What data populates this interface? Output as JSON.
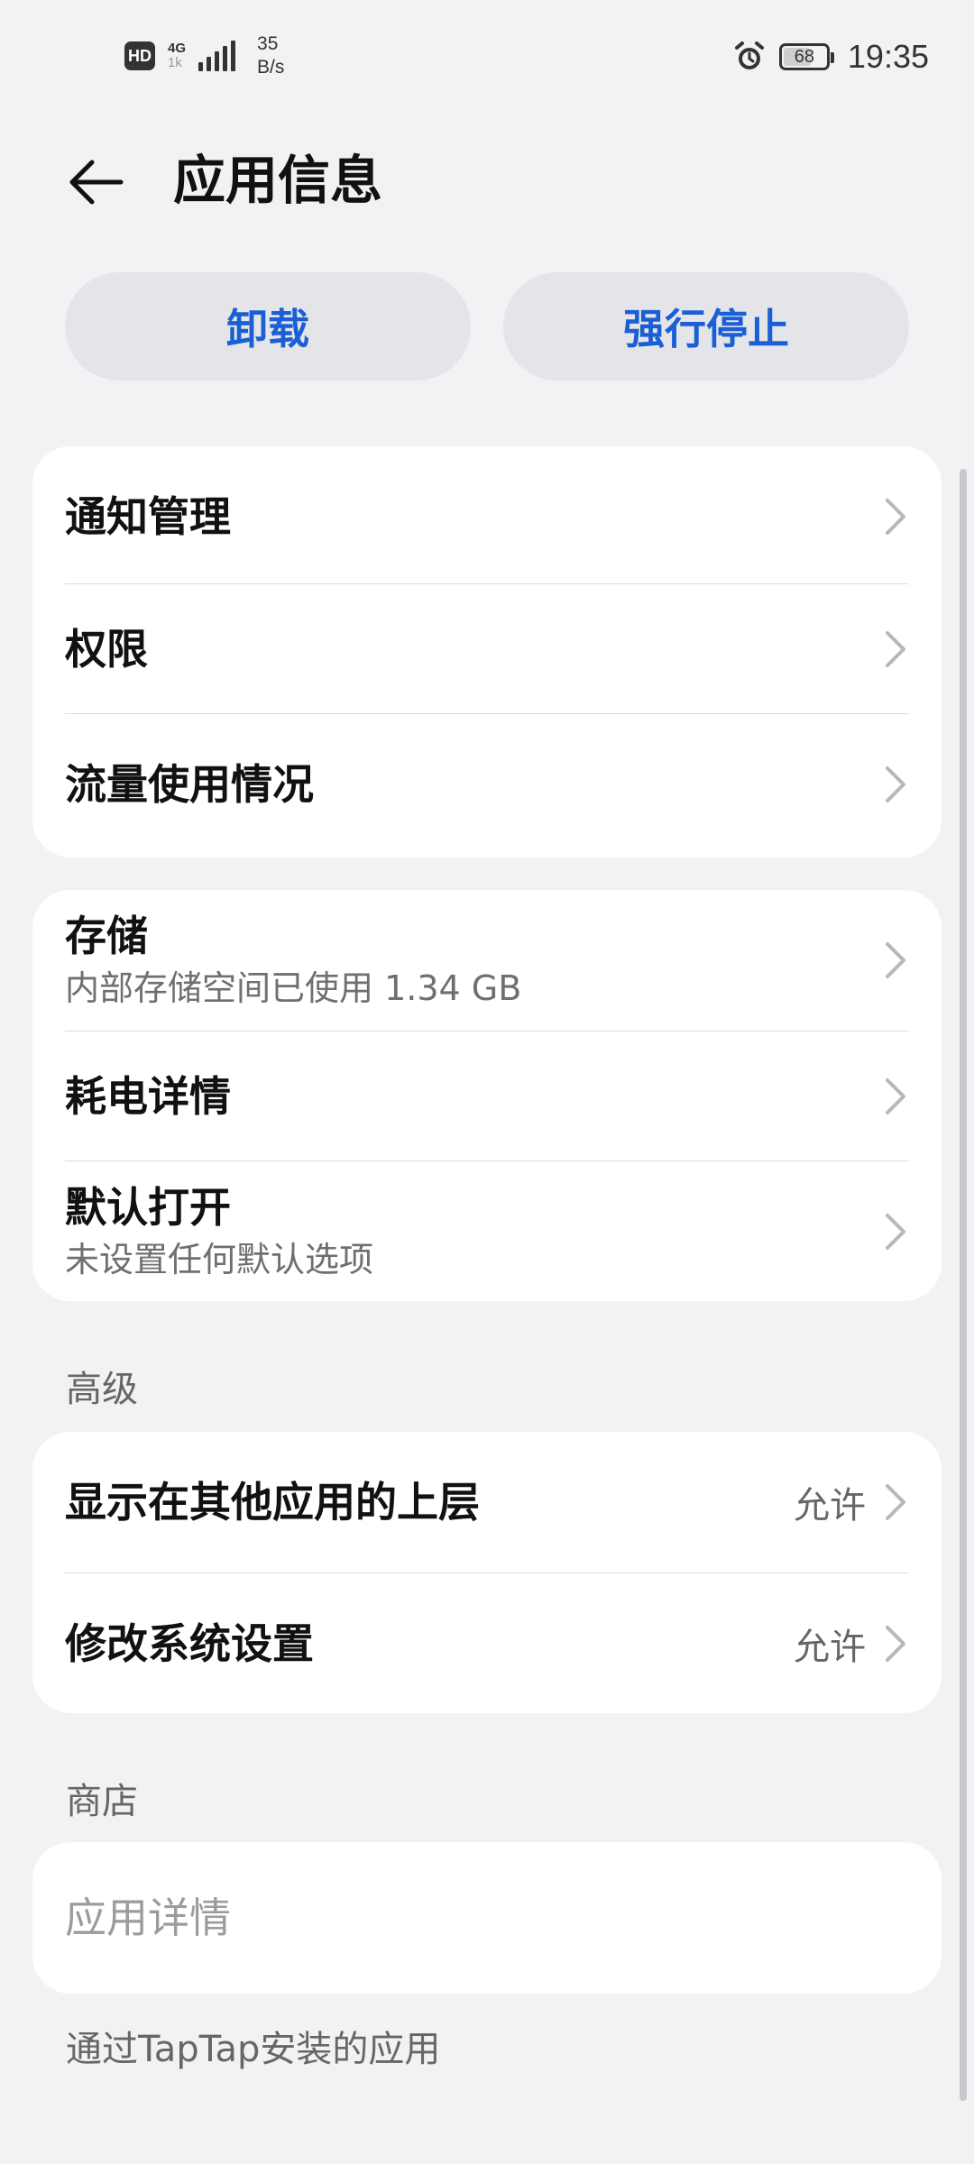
{
  "status_bar": {
    "hd_label": "HD",
    "network_type": "4G",
    "network_sub": "1k",
    "speed_value": "35",
    "speed_unit": "B/s",
    "battery": "68",
    "battery_percent": 68,
    "time": "19:35",
    "icons": [
      "signal-icon",
      "alarm-icon",
      "battery-icon"
    ]
  },
  "header": {
    "title": "应用信息",
    "back_icon": "arrow-left-icon"
  },
  "actions": {
    "uninstall": "卸载",
    "force_stop": "强行停止"
  },
  "card1": {
    "items": [
      {
        "title": "通知管理"
      },
      {
        "title": "权限"
      },
      {
        "title": "流量使用情况"
      }
    ]
  },
  "card2": {
    "items": [
      {
        "title": "存储",
        "subtitle": "内部存储空间已使用 1.34 GB"
      },
      {
        "title": "耗电详情"
      },
      {
        "title": "默认打开",
        "subtitle": "未设置任何默认选项"
      }
    ]
  },
  "advanced": {
    "label": "高级",
    "items": [
      {
        "title": "显示在其他应用的上层",
        "value": "允许"
      },
      {
        "title": "修改系统设置",
        "value": "允许"
      }
    ]
  },
  "store": {
    "label": "商店",
    "items": [
      {
        "title": "应用详情"
      }
    ],
    "note": "通过TapTap安装的应用"
  },
  "colors": {
    "accent": "#1a5fd6",
    "background": "#f1f2f4",
    "card": "#ffffff"
  }
}
